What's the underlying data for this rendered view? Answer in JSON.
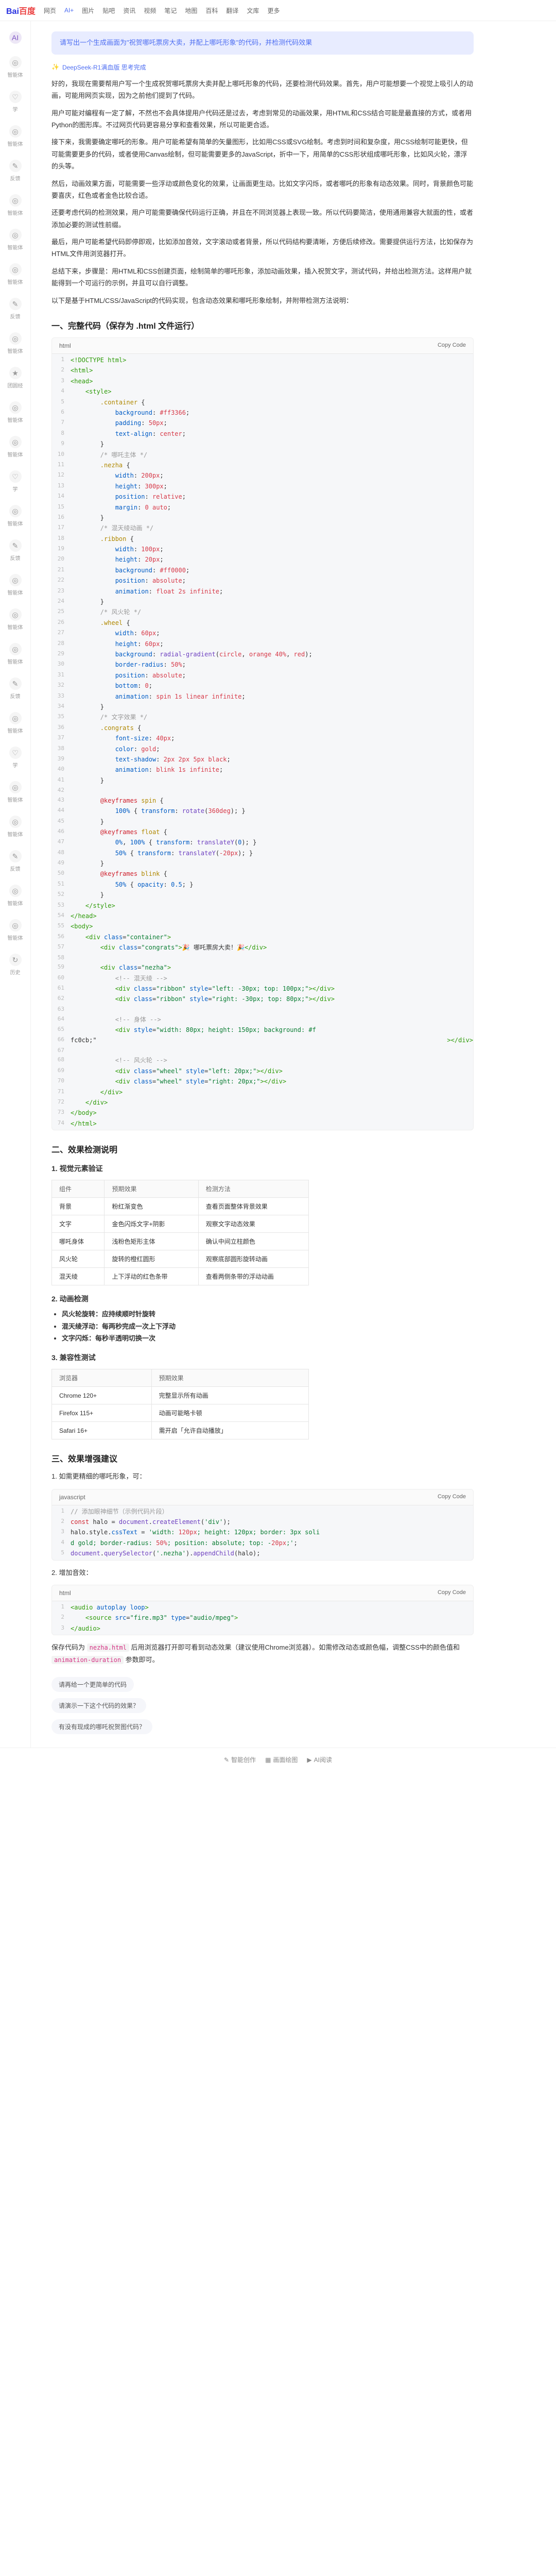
{
  "topnav": {
    "logo": "Bai",
    "logo2": "百度",
    "items": [
      "网页",
      "AI+",
      "图片",
      "贴吧",
      "资讯",
      "视频",
      "笔记",
      "地图",
      "百科",
      "翻译",
      "文库",
      "更多"
    ]
  },
  "sidebar": [
    {
      "label": "AI"
    },
    {
      "label": "智能体"
    },
    {
      "label": "学"
    },
    {
      "label": "智能体"
    },
    {
      "label": "反馈"
    },
    {
      "label": "智能体"
    },
    {
      "label": "智能体"
    },
    {
      "label": "智能体"
    },
    {
      "label": "反馈"
    },
    {
      "label": "智能体"
    },
    {
      "label": "团圆经"
    },
    {
      "label": "智能体"
    },
    {
      "label": "智能体"
    },
    {
      "label": "学"
    },
    {
      "label": "智能体"
    },
    {
      "label": "反馈"
    },
    {
      "label": "智能体"
    },
    {
      "label": "智能体"
    },
    {
      "label": "智能体"
    },
    {
      "label": "反馈"
    },
    {
      "label": "智能体"
    },
    {
      "label": "学"
    },
    {
      "label": "智能体"
    },
    {
      "label": "智能体"
    },
    {
      "label": "反馈"
    },
    {
      "label": "智能体"
    },
    {
      "label": "智能体"
    },
    {
      "label": "历史"
    }
  ],
  "prompt": "请写出一个生成画面为\"祝贺哪吒票房大卖，并配上哪吒形象\"的代码，并检测代码效果",
  "thinking": "DeepSeek-R1满血版  思考完成",
  "resp": {
    "p1": "好的，我现在需要帮用户写一个生成祝贺哪吒票房大卖并配上哪吒形象的代码，还要检测代码效果。首先，用户可能想要一个视觉上吸引人的动画，可能用网页实现，因为之前他们提到了代码。",
    "p2": "用户可能对编程有一定了解，不然也不会具体提用户代码还是过去，考虑到常见的动画效果，用HTML和CSS结合可能是最直接的方式，或者用Python的图形库。不过网页代码更容易分享和查看效果，所以可能更合适。",
    "p3": "接下来，我需要确定哪吒的形象。用户可能希望有简单的矢量图形，比如用CSS或SVG绘制。考虑到时间和复杂度，用CSS绘制可能更快，但可能需要更多的代码，或者使用Canvas绘制，但可能需要更多的JavaScript，折中一下，用简单的CSS形状组成哪吒形象，比如风火轮，漂浮的头等。",
    "p4": "然后，动画效果方面，可能需要一些浮动或颜色变化的效果，让画面更生动。比如文字闪烁，或者哪吒的形象有动态效果。同时，背景颜色可能要喜庆，红色或者金色比较合适。",
    "p5": "还要考虑代码的检测效果，用户可能需要确保代码运行正确，并且在不同浏览器上表现一致。所以代码要简洁，使用通用兼容大就面的性，或者添加必要的测试性前缀。",
    "p6": "最后，用户可能希望代码即停即观，比如添加音效，文字滚动或者背景，所以代码结构要清晰，方便后续修改。需要提供运行方法，比如保存为HTML文件用浏览器打开。",
    "p7": "总结下来，步骤是：用HTML和CSS创建页面，绘制简单的哪吒形象，添加动画效果，插入祝贺文字，测试代码，并给出检测方法。这样用户就能得到一个可运行的示例，并且可以自行调整。",
    "p8": "以下是基于HTML/CSS/JavaScript的代码实现，包含动态效果和哪吒形象绘制，并附带检测方法说明："
  },
  "h1": "一、完整代码（保存为 .html 文件运行）",
  "code1": {
    "lang": "html",
    "copy": "Copy Code"
  },
  "h2": "二、效果检测说明",
  "sec1": {
    "title": "1. 视觉元素验证",
    "th": [
      "组件",
      "预期效果",
      "检测方法"
    ],
    "rows": [
      [
        "背景",
        "粉红渐变色",
        "查看页面整体背景效果"
      ],
      [
        "文字",
        "金色闪烁文字+阴影",
        "观察文字动态效果"
      ],
      [
        "哪吒身体",
        "浅粉色矩形主体",
        "确认中间立柱颜色"
      ],
      [
        "风火轮",
        "旋转的橙红圆形",
        "观察底部圆形旋转动画"
      ],
      [
        "混天绫",
        "上下浮动的红色条带",
        "查看两侧条带的浮动动画"
      ]
    ]
  },
  "sec2": {
    "title": "2. 动画检测",
    "items": [
      "风火轮旋转：应持续顺时针旋转",
      "混天绫浮动：每两秒完成一次上下浮动",
      "文字闪烁：每秒半透明切换一次"
    ]
  },
  "sec3": {
    "title": "3. 兼容性测试",
    "th": [
      "浏览器",
      "预期效果"
    ],
    "rows": [
      [
        "Chrome 120+",
        "完整显示所有动画"
      ],
      [
        "Firefox 115+",
        "动画可能略卡顿"
      ],
      [
        "Safari 16+",
        "需开启「允许自动播放」"
      ]
    ]
  },
  "h3": "三、效果增强建议",
  "sub1": "1. 如需更精细的哪吒形象，可：",
  "code2": {
    "lang": "javascript",
    "copy": "Copy Code"
  },
  "sub2": "2. 增加音效：",
  "code3": {
    "lang": "html",
    "copy": "Copy Code"
  },
  "bottom_note": "保存代码为 nezha.html 后用浏览器打开即可看到动态效果（建议使用Chrome浏览器），如需修改动态或颜色幅，调整CSS中的颜色值和 animation-duration 参数即可。",
  "suggest": [
    "请再给一个更简单的代码",
    "请演示一下这个代码的效果？",
    "有没有现成的哪吒祝贺图代码？"
  ],
  "bottombar": [
    "智能创作",
    "画面绘图",
    "AI阅读"
  ]
}
